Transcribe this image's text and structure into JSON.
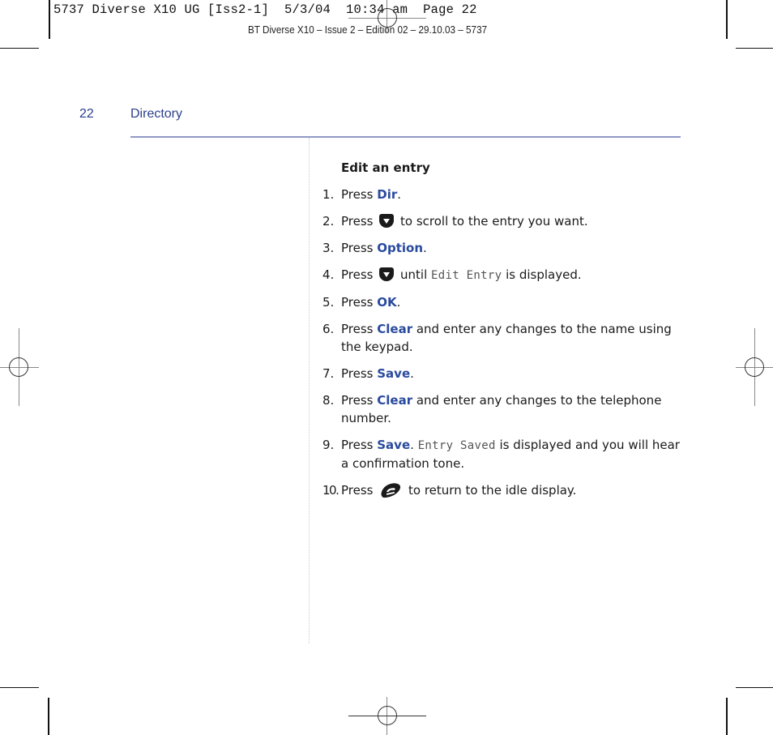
{
  "print_slug": "5737 Diverse X10 UG [Iss2-1]  5/3/04  10:34 am  Page 22",
  "edition_line": "BT Diverse X10 – Issue 2 – Edition 02 – 29.10.03 – 5737",
  "header": {
    "page_number": "22",
    "section_title": "Directory"
  },
  "content": {
    "heading": "Edit an entry",
    "steps": [
      {
        "num": "1.",
        "pre": "Press ",
        "key": "Dir",
        "post": "."
      },
      {
        "num": "2.",
        "pre": "Press ",
        "icon": "down-arrow-key-icon",
        "post": " to scroll to the entry you want."
      },
      {
        "num": "3.",
        "pre": "Press ",
        "key": "Option",
        "post": "."
      },
      {
        "num": "4.",
        "pre": "Press ",
        "icon": "down-arrow-key-icon",
        "mid": " until ",
        "display": "Edit Entry",
        "post": " is displayed."
      },
      {
        "num": "5.",
        "pre": "Press ",
        "key": "OK",
        "post": "."
      },
      {
        "num": "6.",
        "pre": "Press ",
        "key": "Clear",
        "post": " and enter any changes to the name using the keypad."
      },
      {
        "num": "7.",
        "pre": "Press ",
        "key": "Save",
        "post": "."
      },
      {
        "num": "8.",
        "pre": "Press ",
        "key": "Clear",
        "post": " and enter any changes to the telephone number."
      },
      {
        "num": "9.",
        "pre": "Press ",
        "key": "Save",
        "mid": ". ",
        "display": "Entry Saved",
        "post": " is displayed and you will hear a confirmation tone."
      },
      {
        "num": "10.",
        "pre": "Press ",
        "icon": "end-call-key-icon",
        "post": " to return to the idle display."
      }
    ]
  },
  "colors": {
    "accent": "#2a4a9e",
    "header_text": "#2a3f8c",
    "rule": "#9098c8"
  }
}
